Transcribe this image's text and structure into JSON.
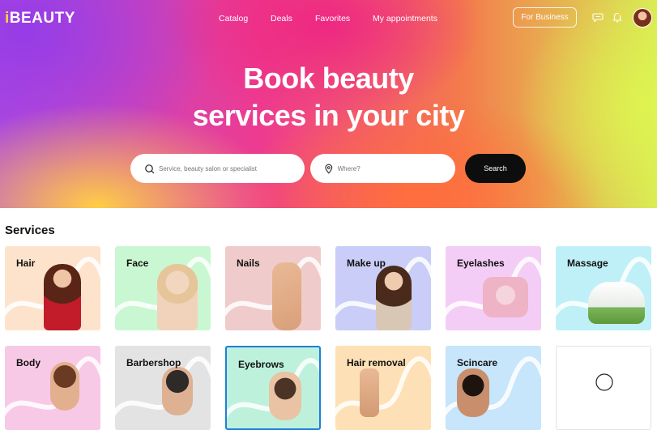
{
  "header": {
    "logo_prefix": "i",
    "logo_rest": "BEAUTY",
    "nav": [
      "Catalog",
      "Deals",
      "Favorites",
      "My appointments"
    ],
    "business_button": "For Business",
    "icons": [
      "chat-icon",
      "bell-icon",
      "avatar"
    ]
  },
  "hero": {
    "headline_line1": "Book beauty",
    "headline_line2": "services in your city",
    "search_placeholder": "Service, beauty salon or specialist",
    "where_placeholder": "Where?",
    "search_button": "Search"
  },
  "services": {
    "title": "Services",
    "items": [
      {
        "label": "Hair",
        "color": "#fde3cc"
      },
      {
        "label": "Face",
        "color": "#c9f7d2"
      },
      {
        "label": "Nails",
        "color": "#f0cbcb"
      },
      {
        "label": "Make up",
        "color": "#c9cdf8"
      },
      {
        "label": "Eyelashes",
        "color": "#f3cdf6"
      },
      {
        "label": "Massage",
        "color": "#bff0f7"
      },
      {
        "label": "Body",
        "color": "#f8c9e6"
      },
      {
        "label": "Barbershop",
        "color": "#e3e3e3"
      },
      {
        "label": "Eyebrows",
        "color": "#bdf1dc"
      },
      {
        "label": "Hair removal",
        "color": "#fde0b5"
      },
      {
        "label": "Scincare",
        "color": "#c7e5fb"
      },
      {
        "label": "",
        "color": "#ffffff"
      }
    ]
  }
}
